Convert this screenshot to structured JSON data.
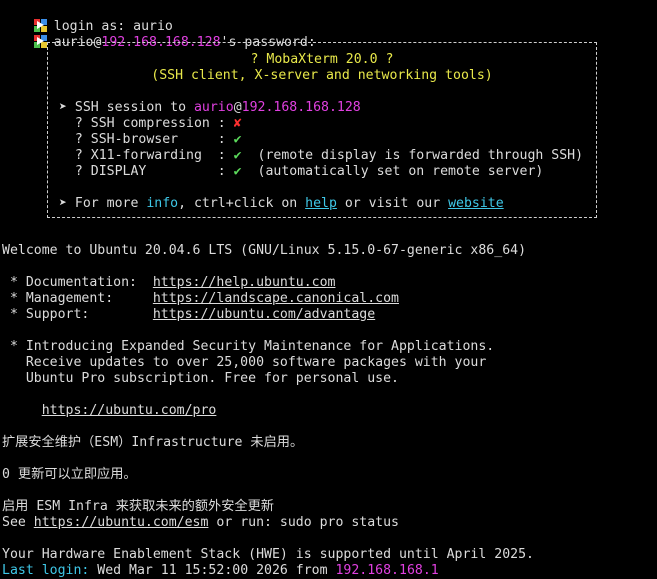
{
  "session": {
    "login_prefix": "login as: ",
    "login_user": "aurio",
    "pw_user": "aurio",
    "pw_at": "@",
    "pw_host": "192.168.168.128",
    "pw_suffix": "'s password:"
  },
  "banner": {
    "title": "? MobaXterm 20.0 ?",
    "subtitle": "(SSH client, X-server and networking tools)",
    "ssh_prefix": "➤ SSH session to ",
    "ssh_user": "aurio",
    "ssh_at": "@",
    "ssh_host": "192.168.168.128",
    "rows": [
      {
        "label": "  ? SSH compression : ",
        "mark": "✘",
        "mark_color": "red",
        "note": ""
      },
      {
        "label": "  ? SSH-browser     : ",
        "mark": "✔",
        "mark_color": "green",
        "note": ""
      },
      {
        "label": "  ? X11-forwarding  : ",
        "mark": "✔",
        "mark_color": "green",
        "note": "  (remote display is forwarded through SSH)"
      },
      {
        "label": "  ? DISPLAY         : ",
        "mark": "✔",
        "mark_color": "green",
        "note": "  (automatically set on remote server)"
      }
    ],
    "more_prefix": "➤ For more ",
    "more_info": "info",
    "more_mid": ", ctrl+click on ",
    "more_help": "help",
    "more_or": " or visit our ",
    "more_website": "website"
  },
  "motd": {
    "welcome": "Welcome to Ubuntu 20.04.6 LTS (GNU/Linux 5.15.0-67-generic x86_64)",
    "doc_label": " * Documentation:  ",
    "doc_url": "https://help.ubuntu.com",
    "mgmt_label": " * Management:     ",
    "mgmt_url": "https://landscape.canonical.com",
    "support_label": " * Support:        ",
    "support_url": "https://ubuntu.com/advantage",
    "esm_1": " * Introducing Expanded Security Maintenance for Applications.",
    "esm_2": "   Receive updates to over 25,000 software packages with your",
    "esm_3": "   Ubuntu Pro subscription. Free for personal use.",
    "pro_indent": "     ",
    "pro_url": "https://ubuntu.com/pro",
    "esm_cn": "扩展安全维护（ESM）Infrastructure 未启用。",
    "updates_cn": "0 更新可以立即应用。",
    "enable_cn": "启用 ESM Infra 来获取未来的额外安全更新",
    "see_prefix": "See ",
    "see_url": "https://ubuntu.com/esm",
    "see_suffix": " or run: sudo pro status",
    "hwe": "Your Hardware Enablement Stack (HWE) is supported until April 2025.",
    "last_label": "Last login:",
    "last_mid": " Wed Mar 11 15:52:00 2026 from ",
    "last_host": "192.168.168.1"
  }
}
